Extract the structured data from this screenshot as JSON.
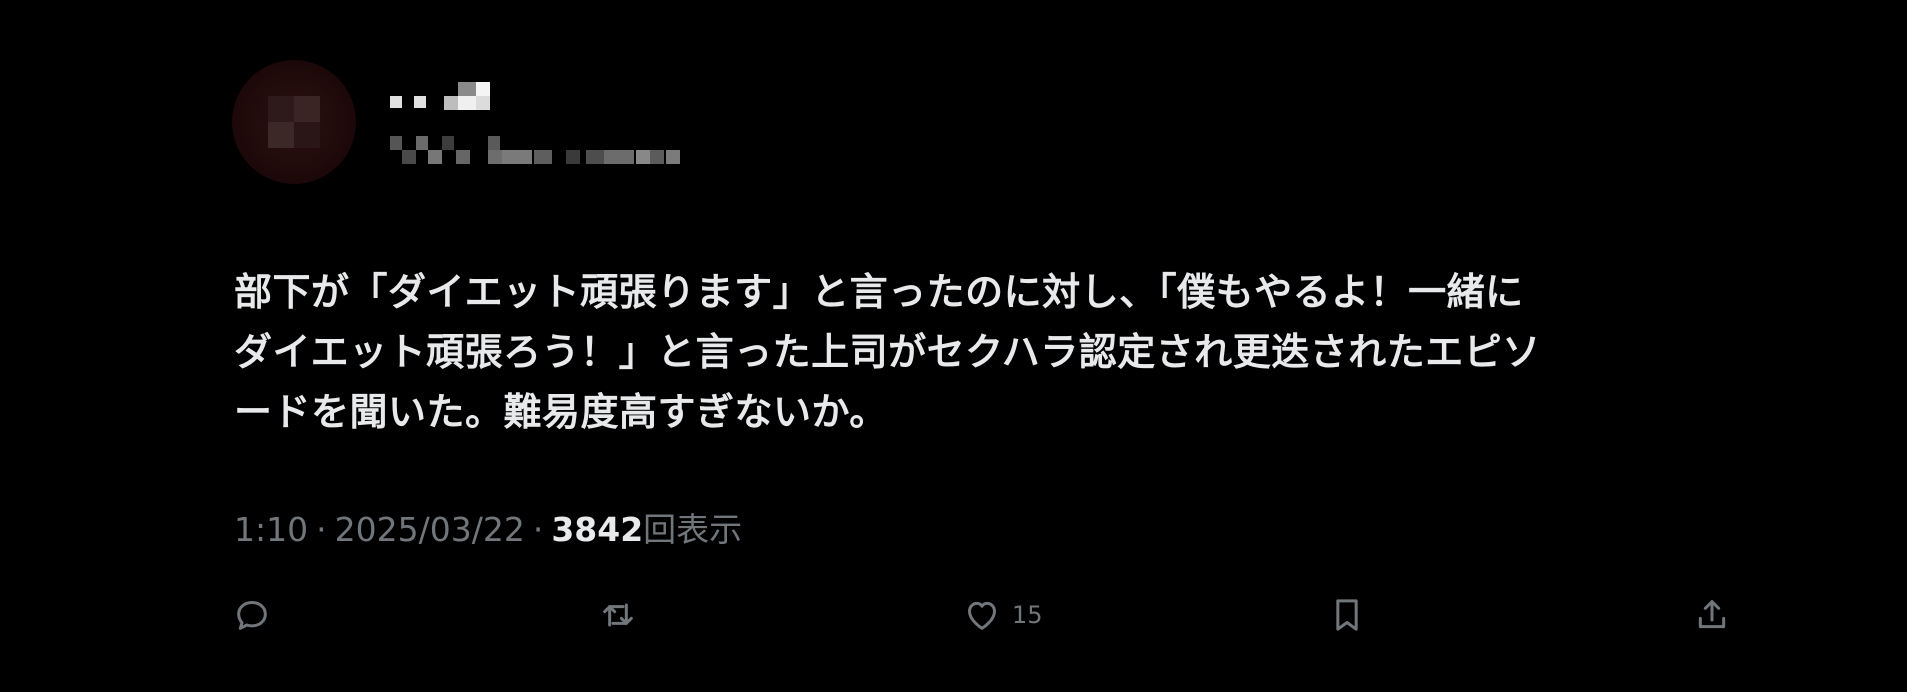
{
  "tweet": {
    "text_lines": [
      "部下が「ダイエット頑張ります」と言ったのに対し、「僕もやるよ！一緒に",
      "ダイエット頑張ろう！」と言った上司がセクハラ認定され更迭されたエピソ",
      "ードを聞いた。難易度高すぎないか。"
    ],
    "time": "1:10",
    "date": "2025/03/22",
    "separator": "·",
    "views_count": "3842",
    "views_label": "回表示"
  },
  "actions": {
    "like_count": "15"
  },
  "icons": {
    "reply": "reply-icon",
    "retweet": "retweet-icon",
    "like": "heart-icon",
    "bookmark": "bookmark-icon",
    "share": "share-icon"
  },
  "colors": {
    "background": "#000000",
    "text": "#e7e9ea",
    "muted": "#71767b"
  }
}
